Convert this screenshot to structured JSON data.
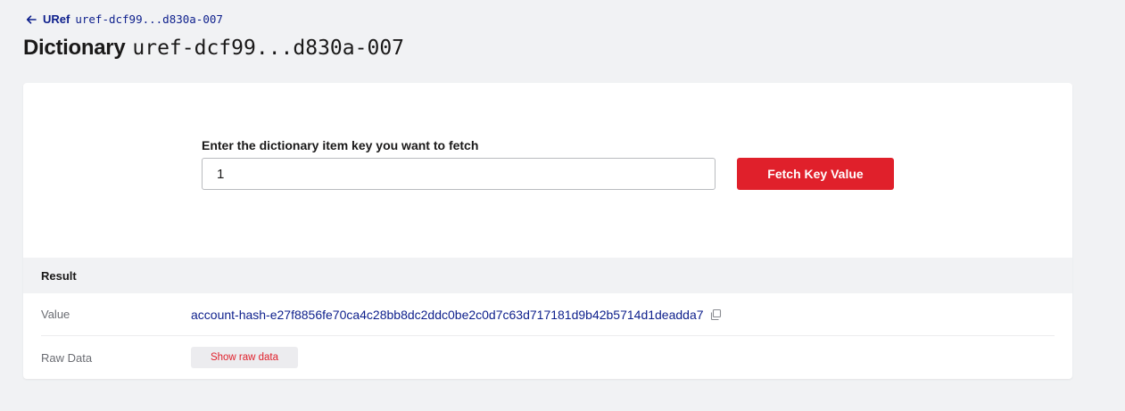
{
  "breadcrumb": {
    "back_label": "URef",
    "back_id": "uref-dcf99...d830a-007"
  },
  "page_title": {
    "label": "Dictionary",
    "id": "uref-dcf99...d830a-007"
  },
  "fetch": {
    "label": "Enter the dictionary item key you want to fetch",
    "input_value": "1",
    "button_label": "Fetch Key Value"
  },
  "result": {
    "header": "Result",
    "value_label": "Value",
    "value": "account-hash-e27f8856fe70ca4c28bb8dc2ddc0be2c0d7c63d717181d9b42b5714d1deadda7",
    "raw_label": "Raw Data",
    "raw_button": "Show raw data"
  },
  "colors": {
    "accent_red": "#e0202b",
    "link_blue": "#0d1f8c",
    "page_bg": "#f1f2f4"
  },
  "icons": [
    "arrow-left-icon",
    "copy-icon"
  ]
}
